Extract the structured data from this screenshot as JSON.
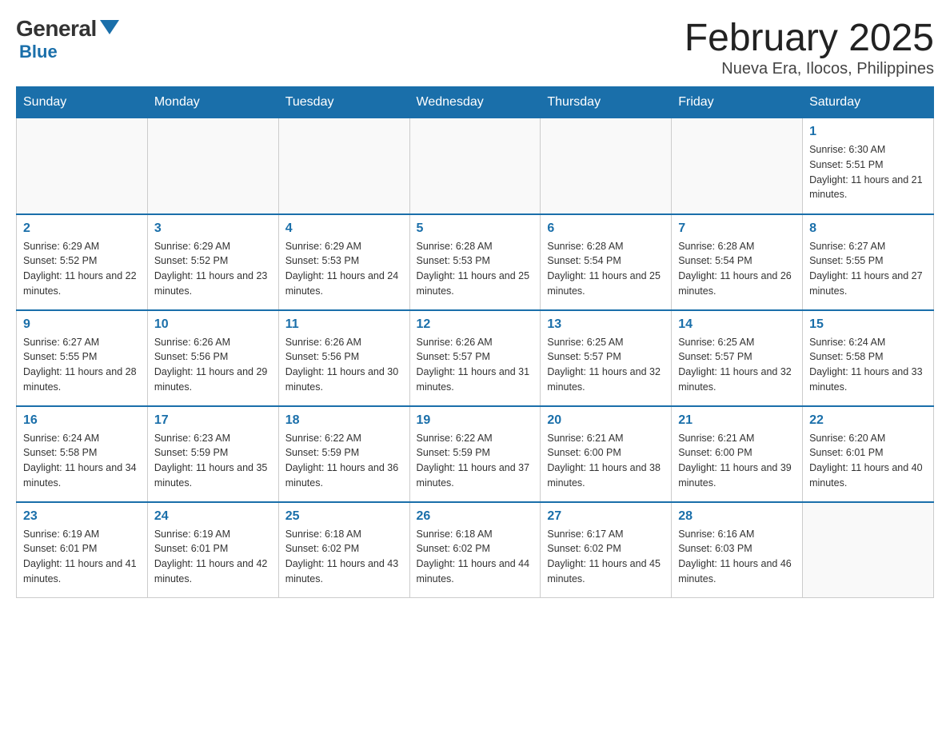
{
  "header": {
    "logo_general": "General",
    "logo_blue": "Blue",
    "month_title": "February 2025",
    "location": "Nueva Era, Ilocos, Philippines"
  },
  "days_of_week": [
    "Sunday",
    "Monday",
    "Tuesday",
    "Wednesday",
    "Thursday",
    "Friday",
    "Saturday"
  ],
  "weeks": [
    [
      {
        "day": "",
        "info": ""
      },
      {
        "day": "",
        "info": ""
      },
      {
        "day": "",
        "info": ""
      },
      {
        "day": "",
        "info": ""
      },
      {
        "day": "",
        "info": ""
      },
      {
        "day": "",
        "info": ""
      },
      {
        "day": "1",
        "info": "Sunrise: 6:30 AM\nSunset: 5:51 PM\nDaylight: 11 hours and 21 minutes."
      }
    ],
    [
      {
        "day": "2",
        "info": "Sunrise: 6:29 AM\nSunset: 5:52 PM\nDaylight: 11 hours and 22 minutes."
      },
      {
        "day": "3",
        "info": "Sunrise: 6:29 AM\nSunset: 5:52 PM\nDaylight: 11 hours and 23 minutes."
      },
      {
        "day": "4",
        "info": "Sunrise: 6:29 AM\nSunset: 5:53 PM\nDaylight: 11 hours and 24 minutes."
      },
      {
        "day": "5",
        "info": "Sunrise: 6:28 AM\nSunset: 5:53 PM\nDaylight: 11 hours and 25 minutes."
      },
      {
        "day": "6",
        "info": "Sunrise: 6:28 AM\nSunset: 5:54 PM\nDaylight: 11 hours and 25 minutes."
      },
      {
        "day": "7",
        "info": "Sunrise: 6:28 AM\nSunset: 5:54 PM\nDaylight: 11 hours and 26 minutes."
      },
      {
        "day": "8",
        "info": "Sunrise: 6:27 AM\nSunset: 5:55 PM\nDaylight: 11 hours and 27 minutes."
      }
    ],
    [
      {
        "day": "9",
        "info": "Sunrise: 6:27 AM\nSunset: 5:55 PM\nDaylight: 11 hours and 28 minutes."
      },
      {
        "day": "10",
        "info": "Sunrise: 6:26 AM\nSunset: 5:56 PM\nDaylight: 11 hours and 29 minutes."
      },
      {
        "day": "11",
        "info": "Sunrise: 6:26 AM\nSunset: 5:56 PM\nDaylight: 11 hours and 30 minutes."
      },
      {
        "day": "12",
        "info": "Sunrise: 6:26 AM\nSunset: 5:57 PM\nDaylight: 11 hours and 31 minutes."
      },
      {
        "day": "13",
        "info": "Sunrise: 6:25 AM\nSunset: 5:57 PM\nDaylight: 11 hours and 32 minutes."
      },
      {
        "day": "14",
        "info": "Sunrise: 6:25 AM\nSunset: 5:57 PM\nDaylight: 11 hours and 32 minutes."
      },
      {
        "day": "15",
        "info": "Sunrise: 6:24 AM\nSunset: 5:58 PM\nDaylight: 11 hours and 33 minutes."
      }
    ],
    [
      {
        "day": "16",
        "info": "Sunrise: 6:24 AM\nSunset: 5:58 PM\nDaylight: 11 hours and 34 minutes."
      },
      {
        "day": "17",
        "info": "Sunrise: 6:23 AM\nSunset: 5:59 PM\nDaylight: 11 hours and 35 minutes."
      },
      {
        "day": "18",
        "info": "Sunrise: 6:22 AM\nSunset: 5:59 PM\nDaylight: 11 hours and 36 minutes."
      },
      {
        "day": "19",
        "info": "Sunrise: 6:22 AM\nSunset: 5:59 PM\nDaylight: 11 hours and 37 minutes."
      },
      {
        "day": "20",
        "info": "Sunrise: 6:21 AM\nSunset: 6:00 PM\nDaylight: 11 hours and 38 minutes."
      },
      {
        "day": "21",
        "info": "Sunrise: 6:21 AM\nSunset: 6:00 PM\nDaylight: 11 hours and 39 minutes."
      },
      {
        "day": "22",
        "info": "Sunrise: 6:20 AM\nSunset: 6:01 PM\nDaylight: 11 hours and 40 minutes."
      }
    ],
    [
      {
        "day": "23",
        "info": "Sunrise: 6:19 AM\nSunset: 6:01 PM\nDaylight: 11 hours and 41 minutes."
      },
      {
        "day": "24",
        "info": "Sunrise: 6:19 AM\nSunset: 6:01 PM\nDaylight: 11 hours and 42 minutes."
      },
      {
        "day": "25",
        "info": "Sunrise: 6:18 AM\nSunset: 6:02 PM\nDaylight: 11 hours and 43 minutes."
      },
      {
        "day": "26",
        "info": "Sunrise: 6:18 AM\nSunset: 6:02 PM\nDaylight: 11 hours and 44 minutes."
      },
      {
        "day": "27",
        "info": "Sunrise: 6:17 AM\nSunset: 6:02 PM\nDaylight: 11 hours and 45 minutes."
      },
      {
        "day": "28",
        "info": "Sunrise: 6:16 AM\nSunset: 6:03 PM\nDaylight: 11 hours and 46 minutes."
      },
      {
        "day": "",
        "info": ""
      }
    ]
  ]
}
